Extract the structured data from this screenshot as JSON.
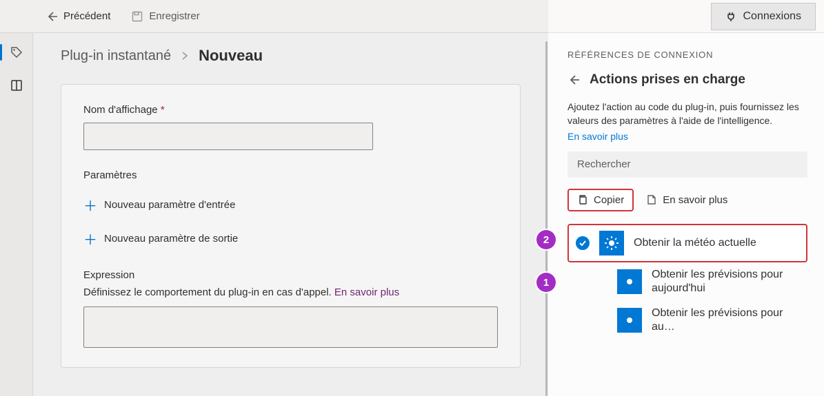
{
  "toolbar": {
    "back_label": "Précédent",
    "save_label": "Enregistrer",
    "connections_label": "Connexions"
  },
  "breadcrumb": {
    "parent": "Plug-in instantané",
    "current": "Nouveau"
  },
  "form": {
    "display_name_label": "Nom d'affichage",
    "display_name_value": "",
    "params_title": "Paramètres",
    "new_input_param": "Nouveau paramètre d'entrée",
    "new_output_param": "Nouveau paramètre de sortie",
    "expression_title": "Expression",
    "expression_desc": "Définissez le comportement du plug-in en cas d'appel. ",
    "expression_more": "En savoir plus"
  },
  "panel": {
    "heading": "RÉFÉRENCES DE CONNEXION",
    "subheading": "Actions prises en charge",
    "description": "Ajoutez l'action au code du plug-in, puis fournissez les valeurs des paramètres à l'aide de l'intelligence.",
    "learn_more": "En savoir plus",
    "search_placeholder": "Rechercher",
    "copy_label": "Copier",
    "more_label": "En savoir plus",
    "actions": [
      {
        "label": "Obtenir la météo actuelle",
        "selected": true
      },
      {
        "label": "Obtenir les prévisions pour aujourd'hui",
        "selected": false
      },
      {
        "label": "Obtenir les prévisions pour au…",
        "selected": false
      }
    ]
  },
  "annotations": {
    "step1": "1",
    "step2": "2"
  }
}
